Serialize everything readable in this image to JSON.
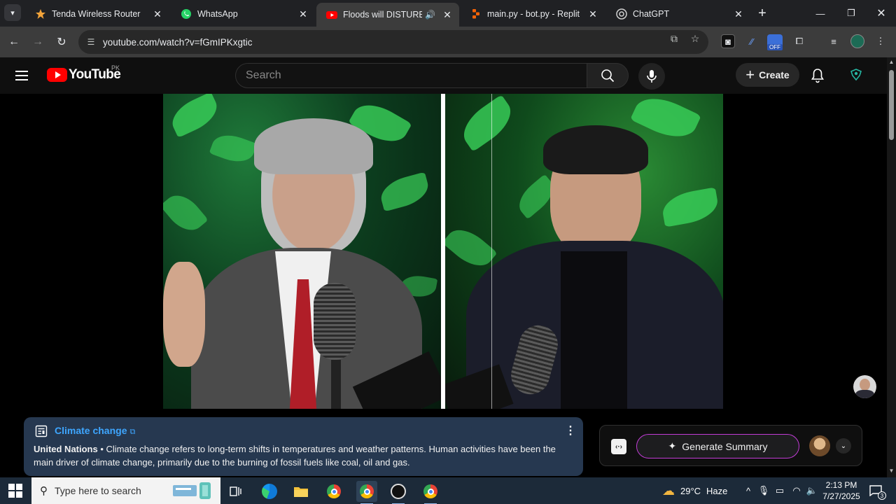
{
  "browser": {
    "tabs": [
      {
        "title": "Tenda Wireless Router",
        "icon": "tenda-icon"
      },
      {
        "title": "WhatsApp",
        "icon": "whatsapp-icon"
      },
      {
        "title": "Floods will DISTURB Pak",
        "icon": "youtube-icon",
        "active": true
      },
      {
        "title": "main.py - bot.py - Replit",
        "icon": "replit-icon"
      },
      {
        "title": "ChatGPT",
        "icon": "chatgpt-icon"
      }
    ],
    "url": "youtube.com/watch?v=fGmIPKxgtic",
    "extension_badge": "OFF"
  },
  "youtube": {
    "logo_text": "YouTube",
    "country_code": "PK",
    "search_placeholder": "Search",
    "create_label": "Create"
  },
  "info_panel": {
    "topic_link": "Climate change",
    "source": "United Nations",
    "separator": " • ",
    "text": "Climate change refers to long-term shifts in temperatures and weather patterns. Human activities have been the main driver of climate change, primarily due to the burning of fossil fuels like coal, oil and gas."
  },
  "summary_widget": {
    "logo_text": "‹·›",
    "button_label": "Generate Summary"
  },
  "taskbar": {
    "search_placeholder": "Type here to search",
    "weather_temp": "29°C",
    "weather_desc": "Haze",
    "time": "2:13 PM",
    "date": "7/27/2025",
    "notification_count": "3"
  },
  "colors": {
    "accent_link": "#3ea6ff",
    "youtube_red": "#ff0000",
    "info_bg": "#263850",
    "summary_border": "#c23cd6"
  }
}
